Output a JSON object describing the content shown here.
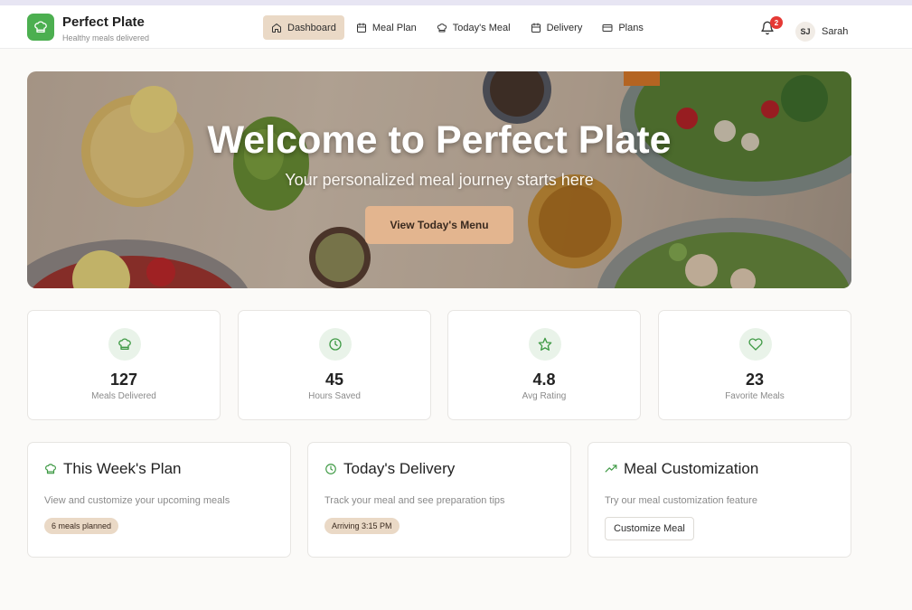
{
  "brand": {
    "name": "Perfect Plate",
    "tagline": "Healthy meals delivered",
    "logo_icon": "chef-hat-icon",
    "accent": "#4caf50"
  },
  "nav": {
    "items": [
      {
        "label": "Dashboard",
        "icon": "home-icon",
        "active": true
      },
      {
        "label": "Meal Plan",
        "icon": "calendar-icon",
        "active": false
      },
      {
        "label": "Today's Meal",
        "icon": "chef-hat-icon",
        "active": false
      },
      {
        "label": "Delivery",
        "icon": "calendar-icon",
        "active": false
      },
      {
        "label": "Plans",
        "icon": "credit-card-icon",
        "active": false
      }
    ]
  },
  "user": {
    "notifications": "2",
    "initials": "SJ",
    "name": "Sarah"
  },
  "hero": {
    "title": "Welcome to Perfect Plate",
    "subtitle": "Your personalized meal journey starts here",
    "button": "View Today's Menu"
  },
  "stats": [
    {
      "value": "127",
      "label": "Meals Delivered",
      "icon": "chef-hat-icon"
    },
    {
      "value": "45",
      "label": "Hours Saved",
      "icon": "clock-icon"
    },
    {
      "value": "4.8",
      "label": "Avg Rating",
      "icon": "star-icon"
    },
    {
      "value": "23",
      "label": "Favorite Meals",
      "icon": "heart-icon"
    }
  ],
  "cards": [
    {
      "title": "This Week's Plan",
      "icon": "chef-hat-icon",
      "description": "View and customize your upcoming meals",
      "badge": "6 meals planned"
    },
    {
      "title": "Today's Delivery",
      "icon": "clock-icon",
      "description": "Track your meal and see preparation tips",
      "badge": "Arriving 3:15 PM"
    },
    {
      "title": "Meal Customization",
      "icon": "trending-up-icon",
      "description": "Try our meal customization feature",
      "button": "Customize Meal"
    }
  ],
  "colors": {
    "accent_green": "#4caf50",
    "nav_active": "#ead9c6",
    "hero_button": "#e3b58f",
    "badge_red": "#e53935"
  }
}
